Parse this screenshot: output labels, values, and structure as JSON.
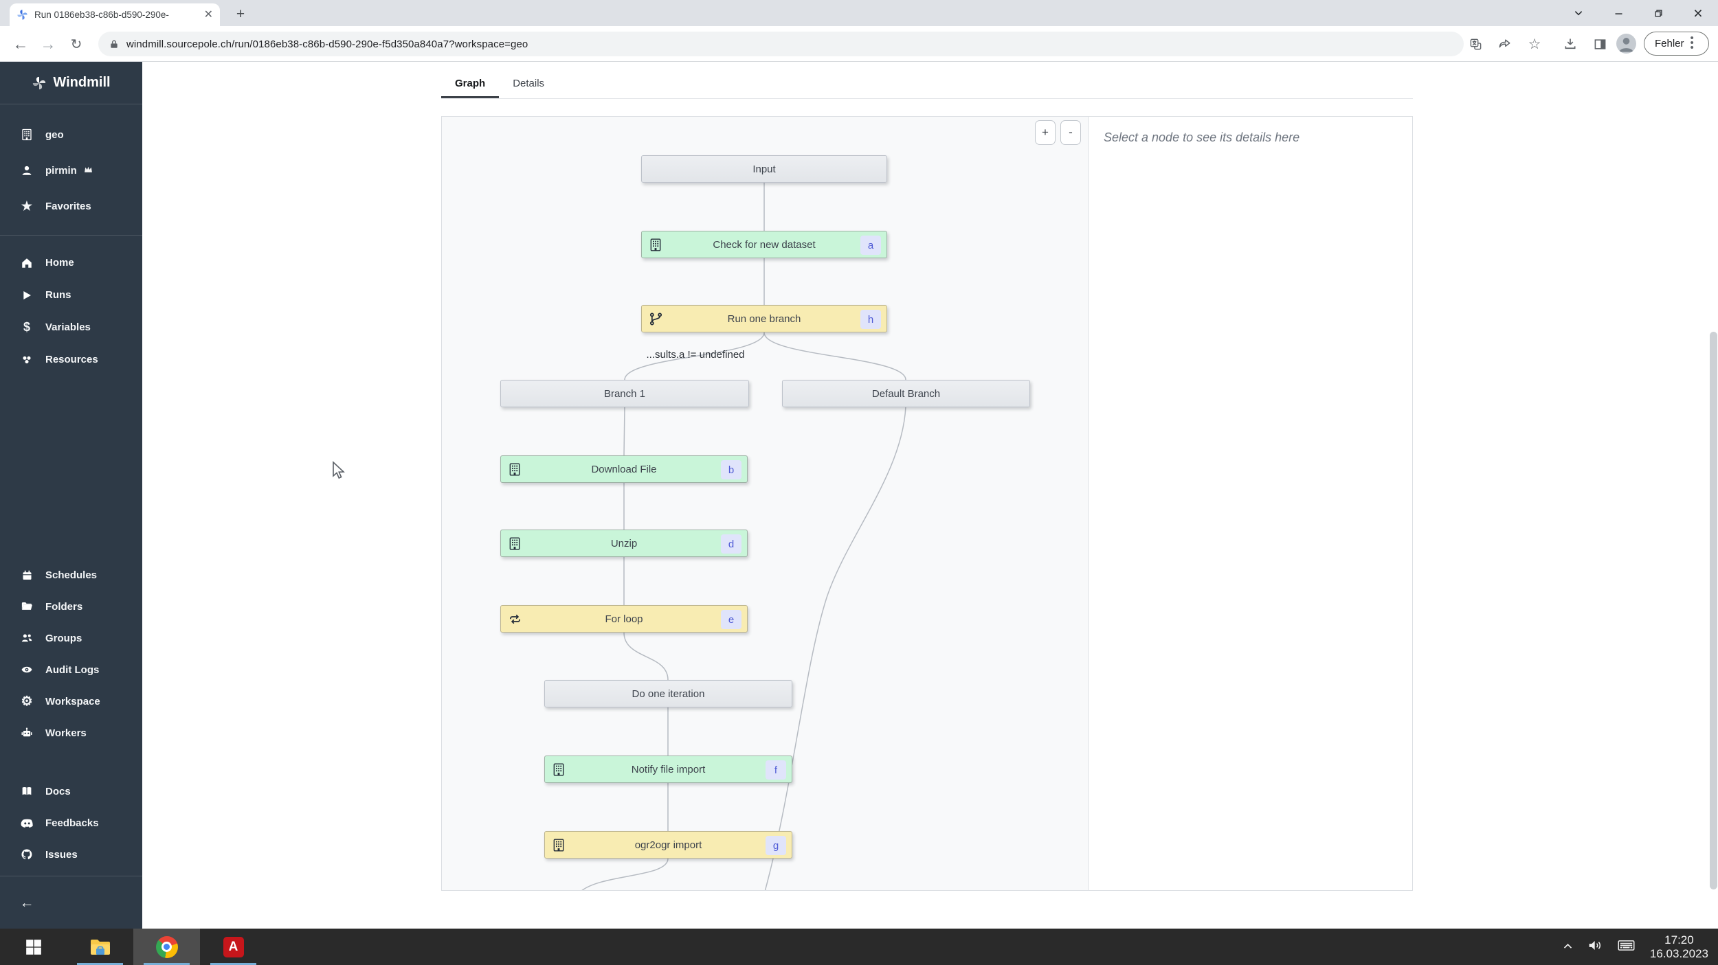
{
  "browser": {
    "tab_title": "Run 0186eb38-c86b-d590-290e-",
    "url": "windmill.sourcepole.ch/run/0186eb38-c86b-d590-290e-f5d350a840a7?workspace=geo",
    "error_button": "Fehler"
  },
  "sidebar": {
    "brand": "Windmill",
    "workspace": {
      "label": "geo"
    },
    "user": {
      "label": "pirmin"
    },
    "favorites": "Favorites",
    "nav": [
      {
        "label": "Home"
      },
      {
        "label": "Runs"
      },
      {
        "label": "Variables"
      },
      {
        "label": "Resources"
      }
    ],
    "admin": [
      {
        "label": "Schedules"
      },
      {
        "label": "Folders"
      },
      {
        "label": "Groups"
      },
      {
        "label": "Audit Logs"
      },
      {
        "label": "Workspace"
      },
      {
        "label": "Workers"
      }
    ],
    "links": [
      {
        "label": "Docs"
      },
      {
        "label": "Feedbacks"
      },
      {
        "label": "Issues"
      }
    ]
  },
  "main": {
    "tabs": [
      {
        "label": "Graph"
      },
      {
        "label": "Details"
      }
    ],
    "graph": {
      "zoom_in": "+",
      "zoom_out": "-",
      "edge_label": "...sults.a != undefined",
      "nodes": [
        {
          "label": "Input",
          "kind": "plain"
        },
        {
          "label": "Check for new dataset",
          "badge": "a",
          "kind": "script"
        },
        {
          "label": "Run one branch",
          "badge": "h",
          "kind": "branch"
        },
        {
          "label": "Branch 1",
          "kind": "plain"
        },
        {
          "label": "Default Branch",
          "kind": "plain"
        },
        {
          "label": "Download File",
          "badge": "b",
          "kind": "script"
        },
        {
          "label": "Unzip",
          "badge": "d",
          "kind": "script"
        },
        {
          "label": "For loop",
          "badge": "e",
          "kind": "loop"
        },
        {
          "label": "Do one iteration",
          "kind": "plain"
        },
        {
          "label": "Notify file import",
          "badge": "f",
          "kind": "script"
        },
        {
          "label": "ogr2ogr import",
          "badge": "g",
          "kind": "script"
        }
      ]
    },
    "details_placeholder": "Select a node to see its details here"
  },
  "taskbar": {
    "time": "17:20",
    "date": "16.03.2023"
  },
  "colors": {
    "sidebar_bg": "#2e3a47",
    "node_green": "#c9f5d9",
    "node_yellow": "#f8ecb2",
    "node_gray": "#e8eaee",
    "badge_bg": "#e0e4fb",
    "badge_text": "#4f5bd5",
    "taskbar_bg": "#2a2a2a",
    "running_underline": "#76aed6"
  }
}
